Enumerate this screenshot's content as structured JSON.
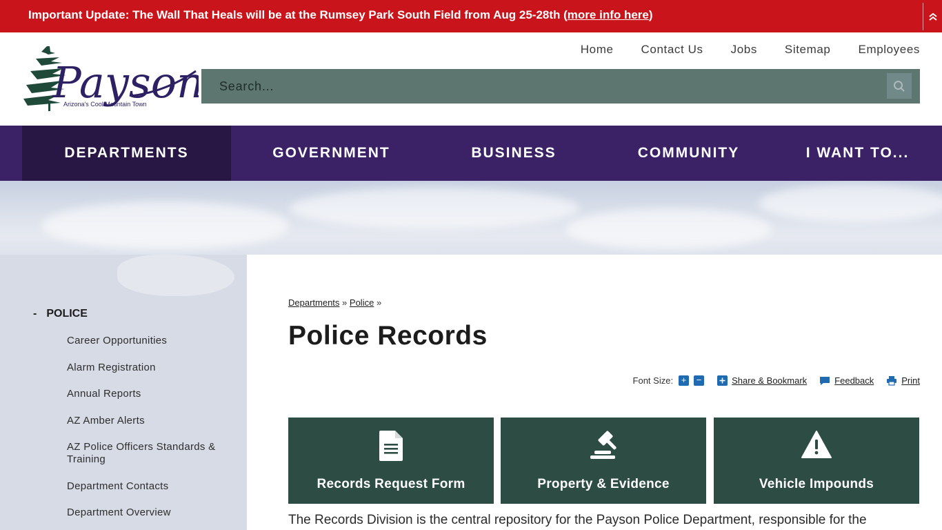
{
  "alert": {
    "text": "Important Update: The Wall That Heals will be at the Rumsey Park South Field from Aug 25-28th (",
    "link": "more info here",
    "close": ")"
  },
  "logo": {
    "name": "Payson",
    "tagline": "Arizona's Cool Mountain Town"
  },
  "top_links": [
    "Home",
    "Contact Us",
    "Jobs",
    "Sitemap",
    "Employees"
  ],
  "search": {
    "placeholder": "Search..."
  },
  "nav": [
    "DEPARTMENTS",
    "GOVERNMENT",
    "BUSINESS",
    "COMMUNITY",
    "I WANT TO..."
  ],
  "sidebar": {
    "dash": "-",
    "heading": "POLICE",
    "items": [
      "Career Opportunities",
      "Alarm Registration",
      "Annual Reports",
      "AZ Amber Alerts",
      "AZ Police Officers Standards & Training",
      "Department Contacts",
      "Department Overview"
    ]
  },
  "breadcrumb": {
    "items": [
      "Departments",
      "Police"
    ],
    "separator": "»"
  },
  "page": {
    "title": "Police Records"
  },
  "tools": {
    "font_size_label": "Font Size:",
    "increase": "+",
    "decrease": "−",
    "share": "Share & Bookmark",
    "feedback": "Feedback",
    "print": "Print"
  },
  "cards": [
    {
      "label": "Records Request Form",
      "icon": "document-icon"
    },
    {
      "label": "Property & Evidence",
      "icon": "gavel-icon"
    },
    {
      "label": "Vehicle Impounds",
      "icon": "warning-icon"
    }
  ],
  "intro": "The Records Division is the central repository for the Payson Police Department, responsible for the",
  "colors": {
    "alert": "#c8141a",
    "nav": "#3b2266",
    "nav_active": "#281744",
    "search": "#5e7670",
    "card": "#2d4d44",
    "sidebar": "#d6dbe5",
    "tool_blue": "#1f6ab0"
  }
}
